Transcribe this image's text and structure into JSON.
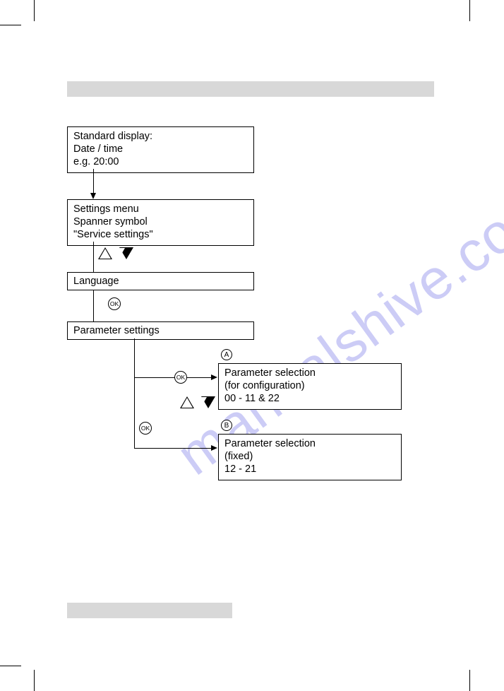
{
  "watermark": "manualshive.com",
  "flow": {
    "box1": {
      "line1": "Standard display:",
      "line2": "Date / time",
      "line3": "e.g.        20:00"
    },
    "box2": {
      "line1": "Settings menu",
      "line2": "Spanner symbol",
      "line3": "\"Service settings\""
    },
    "box3": "Language",
    "box4": "Parameter settings",
    "boxA": {
      "label": "A",
      "line1": "Parameter selection",
      "line2": "(for configuration)",
      "line3": "00 - 11 & 22"
    },
    "boxB": {
      "label": "B",
      "line1": "Parameter selection",
      "line2": "(fixed)",
      "line3": "12 - 21"
    },
    "ok": "OK",
    "plus": "+"
  }
}
